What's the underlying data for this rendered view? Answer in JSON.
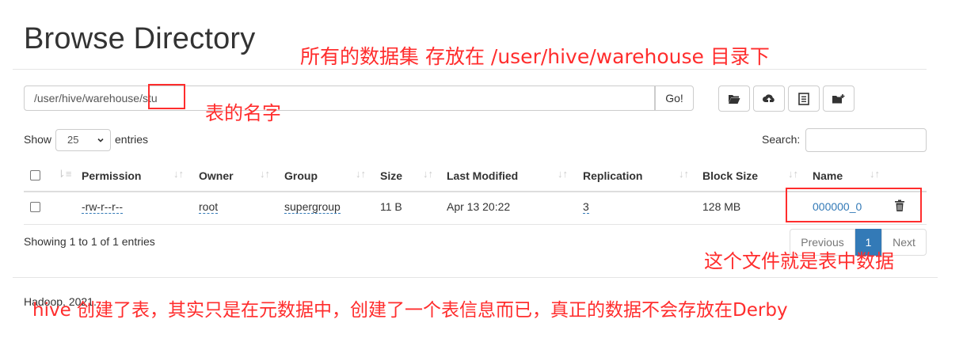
{
  "page": {
    "title": "Browse Directory",
    "footer": "Hadoop, 2021."
  },
  "path_bar": {
    "path": "/user/hive/warehouse/stu",
    "go_label": "Go!"
  },
  "toolbar": {
    "icons": [
      "folder-open-icon",
      "cloud-upload-icon",
      "list-icon",
      "folder-plus-icon"
    ]
  },
  "controls": {
    "show_label": "Show",
    "entries_value": "25",
    "entries_label": "entries",
    "search_label": "Search:"
  },
  "table": {
    "columns": [
      "Permission",
      "Owner",
      "Group",
      "Size",
      "Last Modified",
      "Replication",
      "Block Size",
      "Name"
    ],
    "rows": [
      {
        "permission": "-rw-r--r--",
        "owner": "root",
        "group": "supergroup",
        "size": "11 B",
        "last_modified": "Apr 13 20:22",
        "replication": "3",
        "block_size": "128 MB",
        "name": "000000_0"
      }
    ],
    "info": "Showing 1 to 1 of 1 entries"
  },
  "pagination": {
    "previous": "Previous",
    "current": "1",
    "next": "Next"
  },
  "annotations": {
    "warehouse_note": "所有的数据集 存放在  /user/hive/warehouse 目录下",
    "table_name_note": "表的名字",
    "file_note": "这个文件就是表中数据",
    "bottom_note": "hive 创建了表，其实只是在元数据中，创建了一个表信息而已，真正的数据不会存放在Derby"
  },
  "colors": {
    "annotation": "#ff2d2d",
    "link": "#337ab7",
    "active_page": "#337ab7"
  }
}
